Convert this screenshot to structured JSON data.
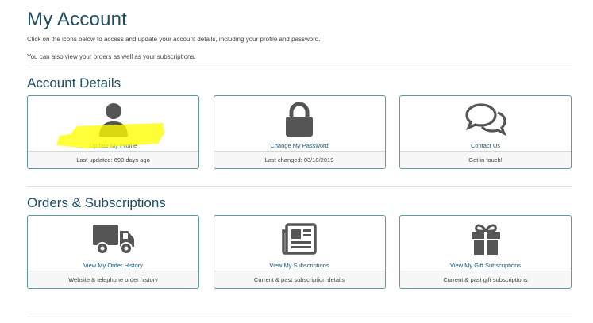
{
  "page": {
    "title": "My Account",
    "intro_line1": "Click on the icons below to access and update your account details, including your profile and password.",
    "intro_line2": "You can also view your orders as well as your subscriptions."
  },
  "account_details": {
    "heading": "Account Details",
    "cards": [
      {
        "label": "Update My Profile",
        "footer": "Last updated: 690 days ago",
        "icon": "user-icon"
      },
      {
        "label": "Change My Password",
        "footer": "Last changed: 03/10/2019",
        "icon": "lock-icon"
      },
      {
        "label": "Contact Us",
        "footer": "Get in touch!",
        "icon": "chat-bubbles-icon"
      }
    ]
  },
  "orders_subscriptions": {
    "heading": "Orders & Subscriptions",
    "cards": [
      {
        "label": "View My Order History",
        "footer": "Website & telephone order history",
        "icon": "truck-icon"
      },
      {
        "label": "View My Subscriptions",
        "footer": "Current & past subscription details",
        "icon": "newspaper-icon"
      },
      {
        "label": "View My Gift Subscriptions",
        "footer": "Current & past gift subscriptions",
        "icon": "gift-icon"
      }
    ]
  },
  "colors": {
    "heading": "#1d4e63",
    "link": "#1b5877",
    "card_border": "#5b9aa6",
    "icon": "#555555",
    "highlight": "#ffff00"
  }
}
